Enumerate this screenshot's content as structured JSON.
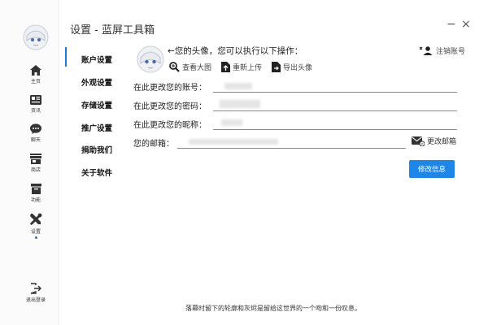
{
  "window": {
    "title": "设置 - 蓝屏工具箱",
    "minimize_glyph": "−",
    "close_glyph": "×"
  },
  "sidebar": {
    "items": [
      {
        "label": "主页",
        "icon": "home-icon"
      },
      {
        "label": "资讯",
        "icon": "news-icon"
      },
      {
        "label": "聊天",
        "icon": "chat-icon"
      },
      {
        "label": "商店",
        "icon": "store-icon"
      },
      {
        "label": "功能",
        "icon": "archive-icon"
      },
      {
        "label": "设置",
        "icon": "tools-icon",
        "active": true
      }
    ],
    "logout_label": "退出登录"
  },
  "settings_nav": {
    "items": [
      {
        "label": "账户设置",
        "active": true
      },
      {
        "label": "外观设置"
      },
      {
        "label": "存储设置"
      },
      {
        "label": "推广设置"
      },
      {
        "label": "捐助我们"
      },
      {
        "label": "关于软件"
      }
    ]
  },
  "account": {
    "avatar_prompt": "←您的头像，您可以执行以下操作：",
    "actions": [
      {
        "label": "查看大图",
        "icon": "zoom-icon"
      },
      {
        "label": "重新上传",
        "icon": "upload-file-icon"
      },
      {
        "label": "导出头像",
        "icon": "export-file-icon"
      }
    ],
    "logout_account_label": "注销账号",
    "fields": [
      {
        "label": "在此更改您的账号："
      },
      {
        "label": "在此更改您的密码："
      },
      {
        "label": "在此更改您的昵称："
      }
    ],
    "email_label": "您的邮箱：",
    "change_email_label": "更改邮箱",
    "submit_label": "修改信息"
  },
  "footer": {
    "text": "落幕时留下的轮廓和灰烬是留给这世界的一个吻和一份叹息。"
  },
  "colors": {
    "accent": "#1e86e6",
    "indicator": "#1a7bdc"
  }
}
